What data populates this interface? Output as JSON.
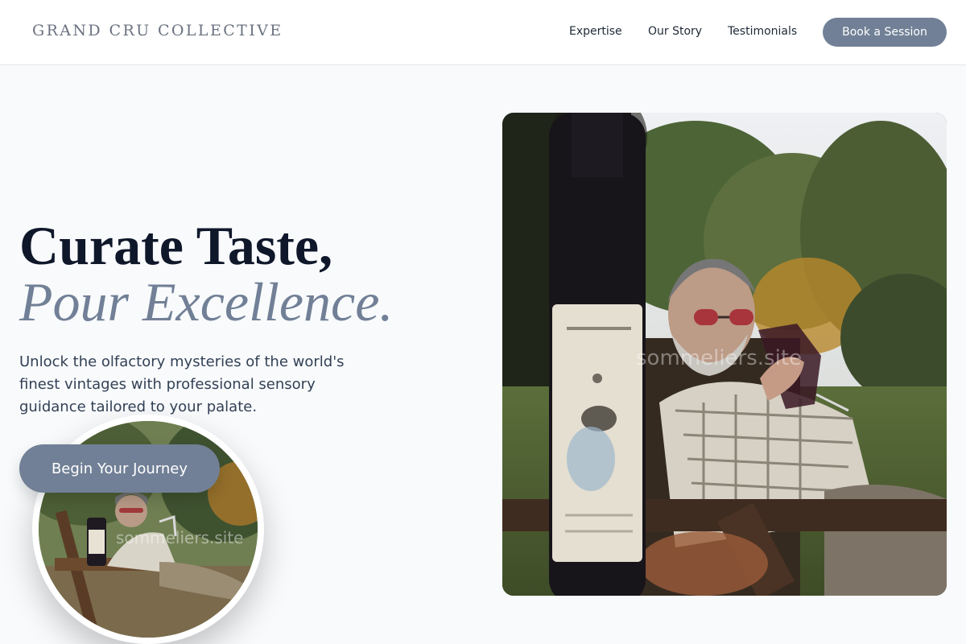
{
  "header": {
    "brand": "GRAND CRU COLLECTIVE",
    "links": [
      {
        "label": "Expertise"
      },
      {
        "label": "Our Story"
      },
      {
        "label": "Testimonials"
      }
    ],
    "cta_label": "Book a Session"
  },
  "hero": {
    "headline_line1": "Curate Taste,",
    "headline_line2": "Pour Excellence.",
    "lead": "Unlock the olfactory mysteries of the world's finest vintages with professional sensory guidance tailored to your palate.",
    "cta_label": "Begin Your Journey"
  },
  "images": {
    "main_watermark": "sommeliers.site",
    "thumb_watermark": "sommeliers.site"
  }
}
